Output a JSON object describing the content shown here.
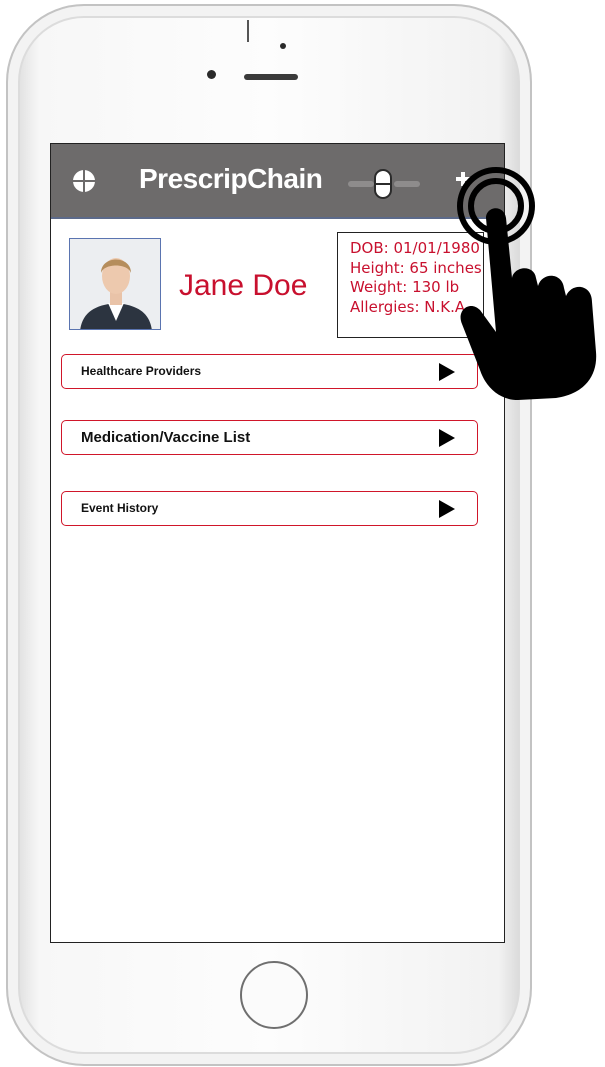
{
  "app": {
    "title": "PrescripChain",
    "menu_icon": "crosshair-circle-icon",
    "logo_icon": "capsule-pill-icon",
    "add_icon": "plus-icon",
    "bar_color": "#6d6b6b",
    "accent_color": "#c8102e"
  },
  "patient": {
    "name": "Jane Doe",
    "photo": "profile-photo",
    "info": {
      "dob": "DOB: 01/01/1980",
      "height": "Height: 65 inches",
      "weight": "Weight: 130 lb",
      "allergies": "Allergies: N.K.A."
    }
  },
  "menu": {
    "items": [
      {
        "label": "Healthcare Providers",
        "icon": "play-arrow-icon"
      },
      {
        "label": "Medication/Vaccine List",
        "icon": "play-arrow-icon"
      },
      {
        "label": "Event History",
        "icon": "play-arrow-icon"
      }
    ]
  },
  "overlay": {
    "icon": "tap-gesture-hand-icon"
  }
}
